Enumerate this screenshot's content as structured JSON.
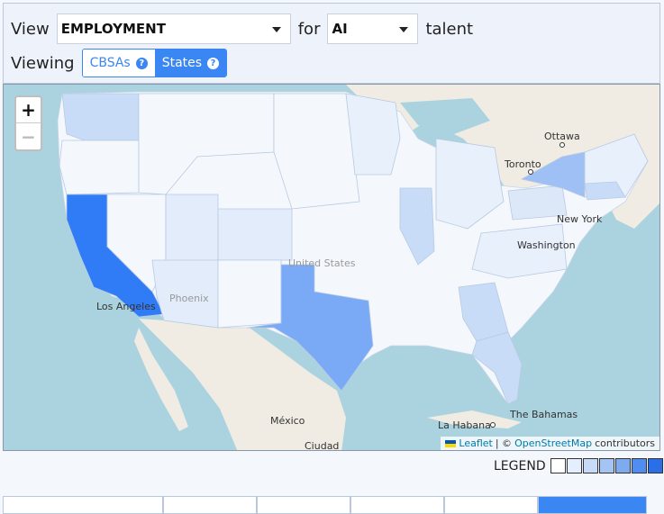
{
  "controls": {
    "view_label": "View",
    "metric_value": "EMPLOYMENT",
    "for_label": "for",
    "talent_value": "AI",
    "talent_label": "talent",
    "viewing_label": "Viewing",
    "toggle_cbsas": "CBSAs",
    "toggle_states": "States",
    "active_toggle": "States"
  },
  "map": {
    "zoom_in": "+",
    "zoom_out": "−",
    "labels": {
      "united_states": "United States",
      "phoenix": "Phoenix",
      "los_angeles": "Los Angeles",
      "mexico": "México",
      "ciudad": "Ciudad",
      "ottawa": "Ottawa",
      "toronto": "Toronto",
      "new_york": "New York",
      "washington": "Washington",
      "la_habana": "La Habana",
      "the_bahamas": "The Bahamas"
    },
    "attribution": {
      "leaflet": "Leaflet",
      "sep": "| ©",
      "osm": "OpenStreetMap",
      "contributors": "contributors"
    },
    "choropleth_scale": [
      "#f4f8fd",
      "#e2ecfa",
      "#c9dcf7",
      "#a6c6f5",
      "#7aaaf5",
      "#4d8ff5",
      "#2f7cf6"
    ],
    "highlight_states": {
      "California": 6,
      "Texas": 5,
      "New York": 4,
      "Washington": 3,
      "Illinois": 3,
      "Georgia": 2,
      "Florida": 2,
      "Massachusetts": 3,
      "Colorado": 2
    }
  },
  "legend": {
    "label": "LEGEND",
    "colors": [
      "#ffffff",
      "#e4eefc",
      "#c7dbf8",
      "#a3c4f4",
      "#7eabf0",
      "#4f8df0",
      "#2a6fe8",
      "#2e3b50"
    ]
  }
}
